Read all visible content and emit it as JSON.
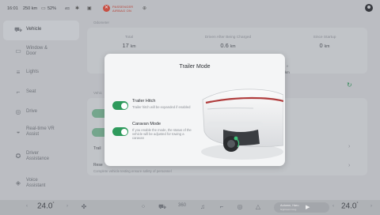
{
  "status_bar": {
    "time": "16:01",
    "range": "250 km",
    "battery": "52%",
    "signal": "4G",
    "passenger_airbag_line1": "PASSENGER",
    "passenger_airbag_line2": "AIRBAG ON"
  },
  "sidebar": {
    "items": [
      {
        "label": "Vehicle",
        "icon": "car-icon",
        "active": true
      },
      {
        "label": "Window &\nDoor",
        "icon": "window-icon"
      },
      {
        "label": "Lights",
        "icon": "lights-icon"
      },
      {
        "label": "Seat",
        "icon": "seat-icon"
      },
      {
        "label": "Drive",
        "icon": "steering-wheel-icon"
      },
      {
        "label": "Real-time VR\nAssist",
        "icon": "vr-assist-icon"
      },
      {
        "label": "Driver\nAssistance",
        "icon": "driver-assistance-icon"
      },
      {
        "label": "Voice\nAssistant",
        "icon": "voice-assistant-icon"
      }
    ]
  },
  "main": {
    "odometer": {
      "section_title": "Odometer",
      "stats": [
        {
          "label": "Total",
          "value": "17",
          "unit": "km"
        },
        {
          "label": "Driven After Being Charged",
          "value": "0.6",
          "unit": "km"
        },
        {
          "label": "Since Startup",
          "value": "0",
          "unit": "km"
        }
      ]
    },
    "partial": {
      "right_label": "e",
      "right_unit": "km",
      "section_label": "Vehic",
      "row_trailer": "Trail",
      "row_reset": "Rese",
      "reset_desc": "Complete vehicle testing ensure safety of personnel"
    }
  },
  "modal": {
    "title": "Trailer Mode",
    "options": [
      {
        "title": "Trailer Hitch",
        "description": "Trailer hitch will be expanded if enabled",
        "enabled": true
      },
      {
        "title": "Caravan Mode",
        "description": "If you enable the mode, the status of the vehicle will be adjusted for towing a caravan",
        "enabled": true
      }
    ]
  },
  "dock": {
    "temp_left": "24.0",
    "temp_right": "24.0",
    "temp_unit": "°",
    "media_title": "Autumn, Haru",
    "media_subtitle": "Nightswimming",
    "icons": [
      "fan-icon",
      "apps-icon",
      "car-icon",
      "360-view-icon",
      "music-icon",
      "seat-heat-icon",
      "steering-heat-icon",
      "navigation-icon"
    ]
  },
  "colors": {
    "accent_green": "#2e9a5c",
    "passenger_airbag_red": "#d24b3c"
  }
}
